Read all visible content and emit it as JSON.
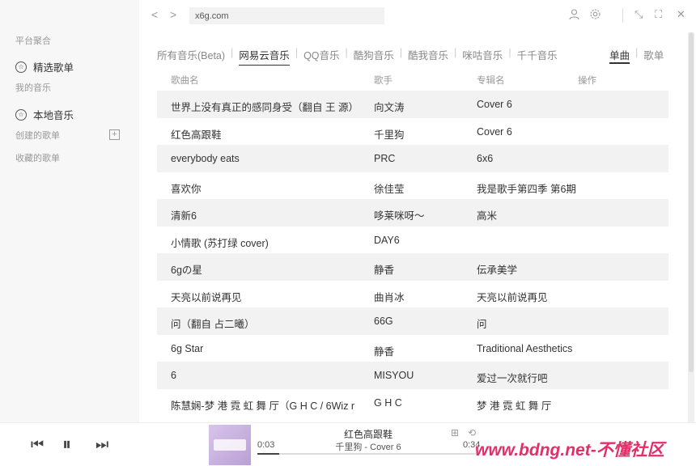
{
  "sidebar": {
    "platform_label": "平台聚合",
    "featured_playlist": "精选歌单",
    "my_music_label": "我的音乐",
    "local_music": "本地音乐",
    "created_playlists_label": "创建的歌单",
    "collected_playlists_label": "收藏的歌单"
  },
  "topbar": {
    "back": "<",
    "forward": ">",
    "url": "x6g.com"
  },
  "tabs": [
    "所有音乐(Beta)",
    "网易云音乐",
    "QQ音乐",
    "酷狗音乐",
    "酷我音乐",
    "咪咕音乐",
    "千千音乐"
  ],
  "active_tab": 1,
  "right_tabs": {
    "single": "单曲",
    "playlist": "歌单"
  },
  "table": {
    "headers": {
      "title": "歌曲名",
      "artist": "歌手",
      "album": "专辑名",
      "action": "操作"
    },
    "rows": [
      {
        "title": "世界上没有真正的感同身受（翻自 王 源）",
        "artist": "向文涛",
        "album": "Cover 6"
      },
      {
        "title": "红色高跟鞋",
        "artist": "千里狗",
        "album": "Cover 6"
      },
      {
        "title": "everybody eats",
        "artist": "PRC",
        "album": "6x6"
      },
      {
        "title": "喜欢你",
        "artist": "徐佳莹",
        "album": "我是歌手第四季 第6期"
      },
      {
        "title": "清新6",
        "artist": "哆莱咪呀～",
        "album": "高米"
      },
      {
        "title": "小情歌 (苏打绿 cover)",
        "artist": "DAY6",
        "album": ""
      },
      {
        "title": "6gの星",
        "artist": "静香",
        "album": "伝承美学"
      },
      {
        "title": "天亮以前说再见",
        "artist": "曲肖冰",
        "album": "天亮以前说再见"
      },
      {
        "title": "问（翻自 占二曦）",
        "artist": "66G",
        "album": "问"
      },
      {
        "title": "6g Star",
        "artist": "静香",
        "album": "Traditional Aesthetics"
      },
      {
        "title": "6",
        "artist": "MISYOU",
        "album": "爱过一次就行吧"
      },
      {
        "title": "陈慧娴-梦 港 霓 虹 舞 厅（G H C / 6Wiz r",
        "artist": "G H C",
        "album": "梦 港 霓 虹 舞 厅"
      }
    ]
  },
  "player": {
    "title": "红色高跟鞋",
    "subtitle": "千里狗 - Cover 6",
    "current_time": "0:03",
    "total_time": "0:34",
    "progress": 0.1
  },
  "watermark": "www.bdng.net-不懂社区",
  "colors": {
    "accent": "#333333",
    "watermark": "#e0306a"
  }
}
